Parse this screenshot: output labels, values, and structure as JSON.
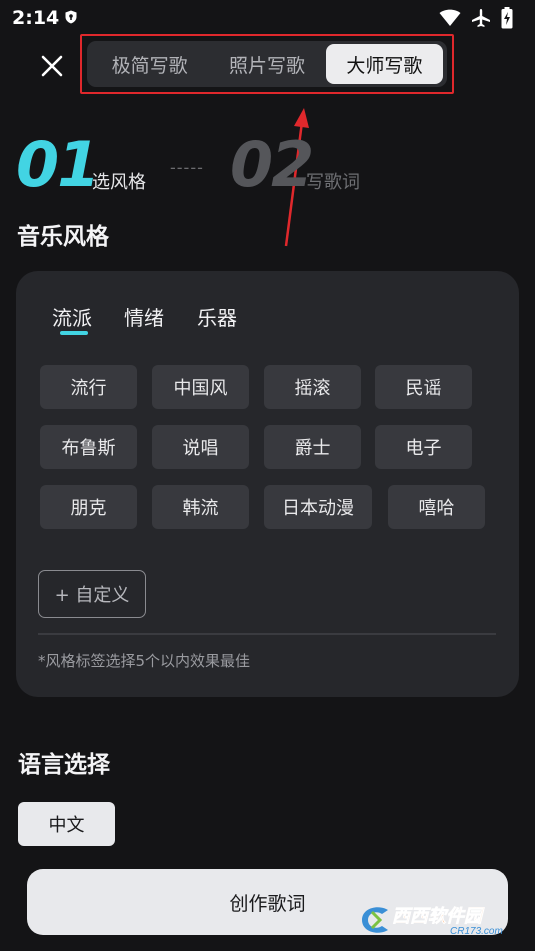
{
  "status_bar": {
    "time": "2:14"
  },
  "header": {
    "mode_tabs": [
      {
        "label": "极简写歌",
        "active": false
      },
      {
        "label": "照片写歌",
        "active": false
      },
      {
        "label": "大师写歌",
        "active": true
      }
    ]
  },
  "steps": [
    {
      "number": "01",
      "label": "选风格"
    },
    {
      "separator": "-----"
    },
    {
      "number": "02",
      "label": "写歌词"
    }
  ],
  "music_style": {
    "title": "音乐风格",
    "category_tabs": [
      {
        "label": "流派",
        "active": true
      },
      {
        "label": "情绪",
        "active": false
      },
      {
        "label": "乐器",
        "active": false
      }
    ],
    "chips": [
      [
        "流行",
        "中国风",
        "摇滚",
        "民谣"
      ],
      [
        "布鲁斯",
        "说唱",
        "爵士",
        "电子"
      ],
      [
        "朋克",
        "韩流",
        "日本动漫",
        "嘻哈"
      ]
    ],
    "custom_label": "+ 自定义",
    "hint": "*风格标签选择5个以内效果最佳"
  },
  "language": {
    "title": "语言选择",
    "selected": "中文"
  },
  "create_button": "创作歌词",
  "watermark": {
    "brand": "西西软件园",
    "domain": "CR173.com"
  },
  "colors": {
    "accent": "#42d4e3",
    "background": "#141416",
    "panel": "#26272b",
    "annotation_red": "#e0282c"
  }
}
